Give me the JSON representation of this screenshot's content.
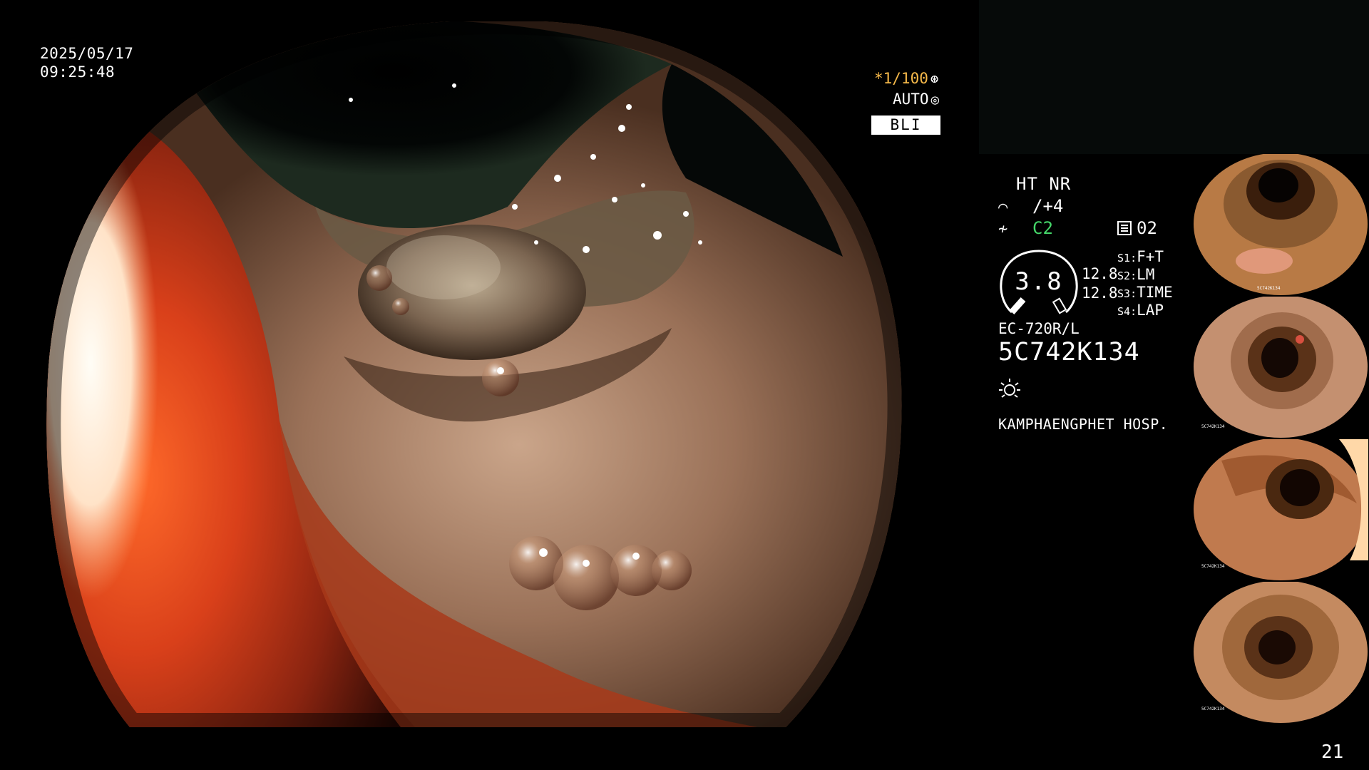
{
  "overlay": {
    "date": "2025/05/17",
    "time": "09:25:48",
    "shutter_speed": "*1/100",
    "shutter_icon": "aperture-icon",
    "exposure_mode": "AUTO",
    "exposure_icon": "iris-icon",
    "imaging_mode": "BLI"
  },
  "panel": {
    "ht_nr": "HT NR",
    "enhancement_icon": "enhancement-icon",
    "enhancement_value": "/+4",
    "color_icon": "color-mode-icon",
    "color_value": "C2",
    "color_value_color": "#45d86a",
    "capture_icon": "document-icon",
    "capture_count": "02",
    "zoom_value": "3.8",
    "ratio_top": "12.8",
    "ratio_bottom": "12.8",
    "switches": [
      {
        "label": "S1",
        "value": "F+T"
      },
      {
        "label": "S2",
        "value": "LM"
      },
      {
        "label": "S3",
        "value": "TIME"
      },
      {
        "label": "S4",
        "value": "LAP"
      }
    ],
    "scope_model": "EC-720R/L",
    "serial": "5C742K134",
    "light_icon": "light-source-icon",
    "hospital": "KAMPHAENGPHET HOSP."
  },
  "thumbnails": [
    {
      "name": "thumbnail-1",
      "label": "5C742K134"
    },
    {
      "name": "thumbnail-2",
      "label": "5C742K134"
    },
    {
      "name": "thumbnail-3",
      "label": "5C742K134"
    },
    {
      "name": "thumbnail-4",
      "label": "5C742K134"
    }
  ],
  "page_number": "21"
}
